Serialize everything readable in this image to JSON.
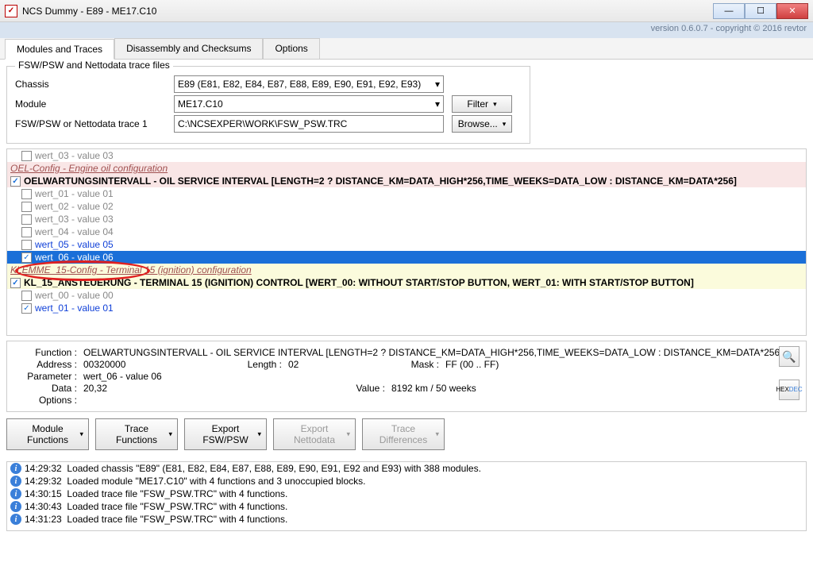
{
  "window": {
    "title": "NCS Dummy - E89 - ME17.C10",
    "version": "version 0.6.0.7 - copyright © 2016 revtor"
  },
  "tabs": {
    "modules": "Modules and Traces",
    "disasm": "Disassembly and Checksums",
    "options": "Options"
  },
  "form": {
    "legend": "FSW/PSW and Nettodata trace files",
    "chassis_label": "Chassis",
    "chassis_value": "E89   (E81, E82, E84, E87, E88, E89, E90, E91, E92, E93)",
    "module_label": "Module",
    "module_value": "ME17.C10",
    "filter_label": "Filter",
    "trace1_label": "FSW/PSW or Nettodata trace 1",
    "trace1_value": "C:\\NCSEXPER\\WORK\\FSW_PSW.TRC",
    "browse_label": "Browse..."
  },
  "list": {
    "top_wert03": "wert_03   -   value 03",
    "oel_hdr": "OEL-Config   -   Engine oil configuration",
    "oel_func": "OELWARTUNGSINTERVALL   -   OIL SERVICE INTERVAL [LENGTH=2 ? DISTANCE_KM=DATA_HIGH*256,TIME_WEEKS=DATA_LOW : DISTANCE_KM=DATA*256]",
    "w01": "wert_01   -   value 01",
    "w02": "wert_02   -   value 02",
    "w03": "wert_03   -   value 03",
    "w04": "wert_04   -   value 04",
    "w05": "wert_05   -   value 05",
    "w06": "wert_06   -   value 06",
    "klem_hdr": "KLEMME_15-Config   -   Terminal 15 (ignition) configuration",
    "klem_func": "KL_15_ANSTEUERUNG   -   TERMINAL 15 (IGNITION) CONTROL [WERT_00: WITHOUT START/STOP BUTTON, WERT_01: WITH START/STOP BUTTON]",
    "kw00": "wert_00   -   value 00",
    "kw01": "wert_01   -   value 01"
  },
  "detail": {
    "function_l": "Function :",
    "function_v": "OELWARTUNGSINTERVALL   -   OIL SERVICE INTERVAL [LENGTH=2 ? DISTANCE_KM=DATA_HIGH*256,TIME_WEEKS=DATA_LOW : DISTANCE_KM=DATA*256]",
    "address_l": "Address :",
    "address_v": "00320000",
    "length_l": "Length :",
    "length_v": "02",
    "mask_l": "Mask :",
    "mask_v": "FF   (00 .. FF)",
    "parameter_l": "Parameter :",
    "parameter_v": "wert_06   -   value 06",
    "data_l": "Data :",
    "data_v": "20,32",
    "value_l": "Value :",
    "value_v": "8192 km / 50 weeks",
    "options_l": "Options :",
    "hex": "HEX",
    "dec": "DEC"
  },
  "buttons": {
    "mod_func": "Module Functions",
    "trace_func": "Trace Functions",
    "export_fsw": "Export FSW/PSW",
    "export_netto": "Export Nettodata",
    "trace_diff": "Trace Differences"
  },
  "log": {
    "l1_t": "14:29:32",
    "l1_m": "Loaded chassis \"E89\" (E81, E82, E84, E87, E88, E89, E90, E91, E92 and E93) with 388 modules.",
    "l2_t": "14:29:32",
    "l2_m": "Loaded module \"ME17.C10\" with 4 functions and 3 unoccupied blocks.",
    "l3_t": "14:30:15",
    "l3_m": "Loaded trace file \"FSW_PSW.TRC\" with 4 functions.",
    "l4_t": "14:30:43",
    "l4_m": "Loaded trace file \"FSW_PSW.TRC\" with 4 functions.",
    "l5_t": "14:31:23",
    "l5_m": "Loaded trace file \"FSW_PSW.TRC\" with 4 functions."
  }
}
